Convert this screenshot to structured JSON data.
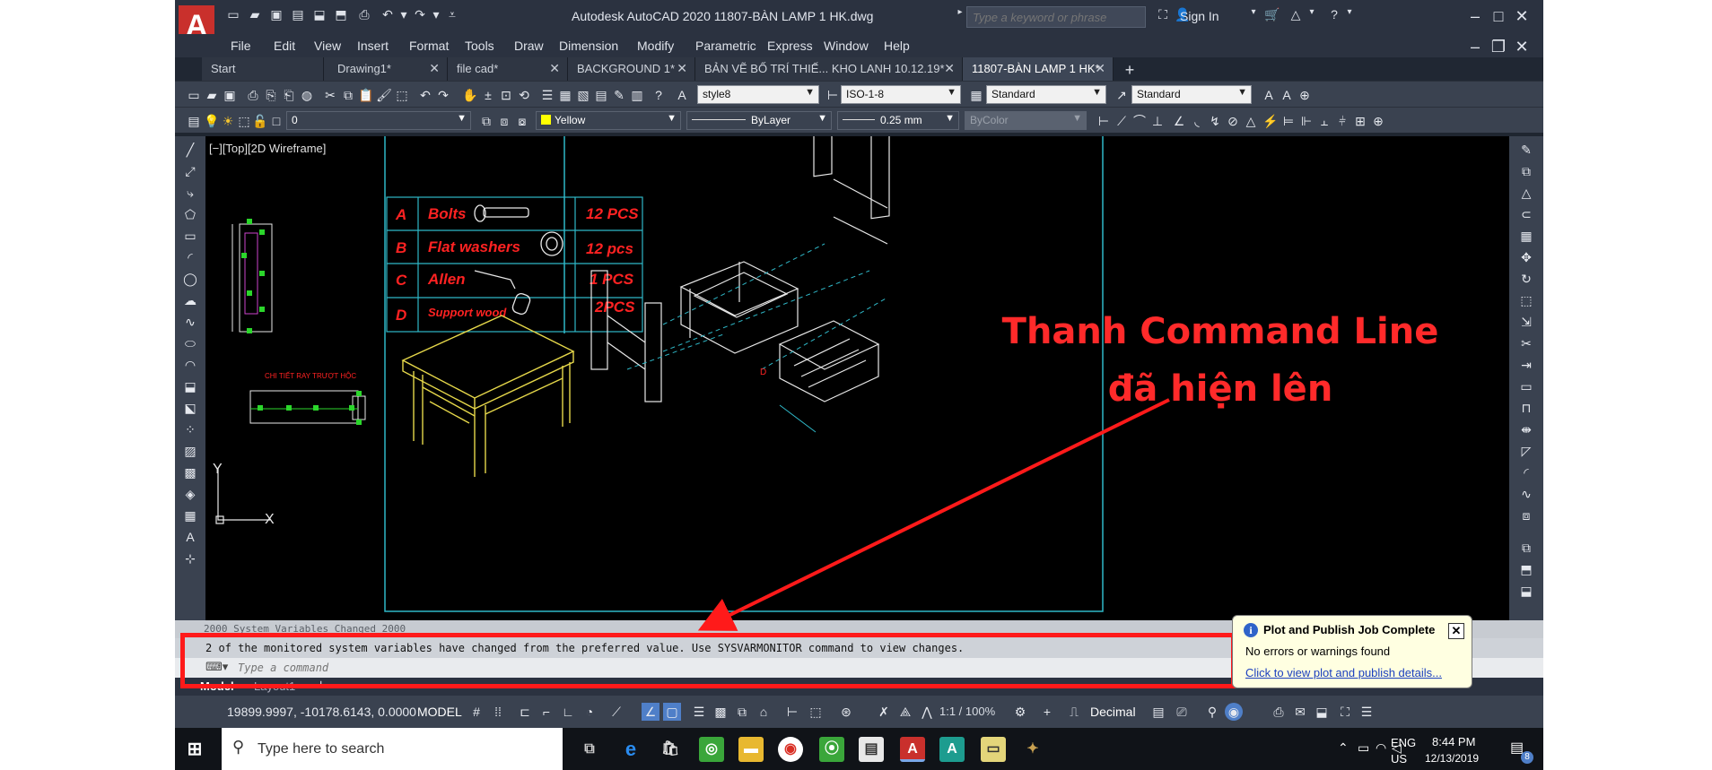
{
  "app": {
    "logo_letter": "A",
    "title": "Autodesk AutoCAD 2020   11807-BÀN LAMP 1 HK.dwg",
    "search_placeholder": "Type a keyword or phrase",
    "sign_in": "Sign In"
  },
  "menu": [
    "File",
    "Edit",
    "View",
    "Insert",
    "Format",
    "Tools",
    "Draw",
    "Dimension",
    "Modify",
    "Parametric",
    "Express",
    "Window",
    "Help"
  ],
  "tabs": [
    {
      "label": "Start",
      "closable": false
    },
    {
      "label": "Drawing1*",
      "closable": true
    },
    {
      "label": "file cad*",
      "closable": true
    },
    {
      "label": "BACKGROUND 1*",
      "closable": true
    },
    {
      "label": "BẢN VẼ BỐ TRÍ THIẾ... KHO LANH 10.12.19*",
      "closable": true
    },
    {
      "label": "11807-BÀN LAMP 1 HK*",
      "closable": true,
      "active": true
    }
  ],
  "toolbar1": {
    "text_style": "style8",
    "dim_style": "ISO-1-8",
    "table_style": "Standard",
    "mleader_style": "Standard"
  },
  "toolbar2": {
    "layer": "0",
    "color": "Yellow",
    "linetype": "ByLayer",
    "lineweight": "0.25 mm",
    "plotstyle": "ByColor"
  },
  "viewport_label": "[−][Top][2D Wireframe]",
  "drawing": {
    "parts": [
      {
        "letter": "A",
        "name": "Bolts",
        "qty": "12 PCS"
      },
      {
        "letter": "B",
        "name": "Flat washers",
        "qty": "12 pcs"
      },
      {
        "letter": "C",
        "name": "Allen",
        "qty": "1 PCS"
      },
      {
        "letter": "D",
        "name": "Support wood",
        "qty": "2PCS"
      }
    ],
    "detail_label": "CHI TIẾT RAY TRƯỢT HỘC",
    "axis_y": "Y",
    "axis_x": "X",
    "marker": "D",
    "annotation_line1": "Thanh Command Line",
    "annotation_line2": "đã hiện lên"
  },
  "command_line": {
    "history": "2000 System Variables Changed 2000",
    "message": "2 of the monitored system variables have changed from the preferred value. Use SYSVARMONITOR command to view changes.",
    "placeholder": "Type a command"
  },
  "layout_tabs": [
    "Model",
    "Layout1"
  ],
  "status_bar": {
    "coords": "19899.9997, -10178.6143, 0.0000",
    "model": "MODEL",
    "scale": "1:1 / 100%",
    "units": "Decimal"
  },
  "notification": {
    "title": "Plot and Publish Job Complete",
    "body": "No errors or warnings found",
    "link": "Click to view plot and publish details..."
  },
  "taskbar": {
    "search_placeholder": "Type here to search",
    "lang_top": "ENG",
    "lang_bottom": "US",
    "time": "8:44 PM",
    "date": "12/13/2019",
    "notify_count": "8"
  },
  "colors": {
    "annotation": "#ff2a2a",
    "parts_table": "#ff2222",
    "frame": "#2fb8c8",
    "chair": "#e6d84a",
    "model": "#e8e8e8"
  }
}
